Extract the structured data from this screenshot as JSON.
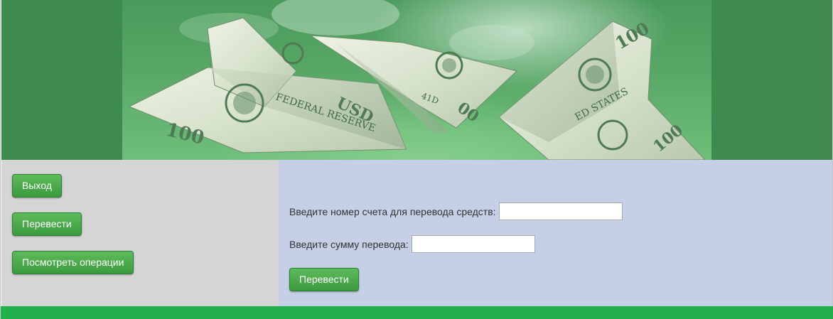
{
  "header": {
    "banner_image": "paper-plane-dollar-bills"
  },
  "sidebar": {
    "exit_label": "Выход",
    "transfer_label": "Перевести",
    "operations_label": "Посмотреть операции"
  },
  "transfer_form": {
    "account_label": "Введите номер счета для перевода средств:",
    "account_value": "",
    "amount_label": "Введите сумму перевода:",
    "amount_value": "",
    "submit_label": "Перевести"
  },
  "colors": {
    "header_bg": "#3f8a4e",
    "sidebar_bg": "#d5d5d5",
    "main_bg": "#c5d0e6",
    "button_green": "#3a9a3d",
    "footer_bg": "#21b04b"
  }
}
